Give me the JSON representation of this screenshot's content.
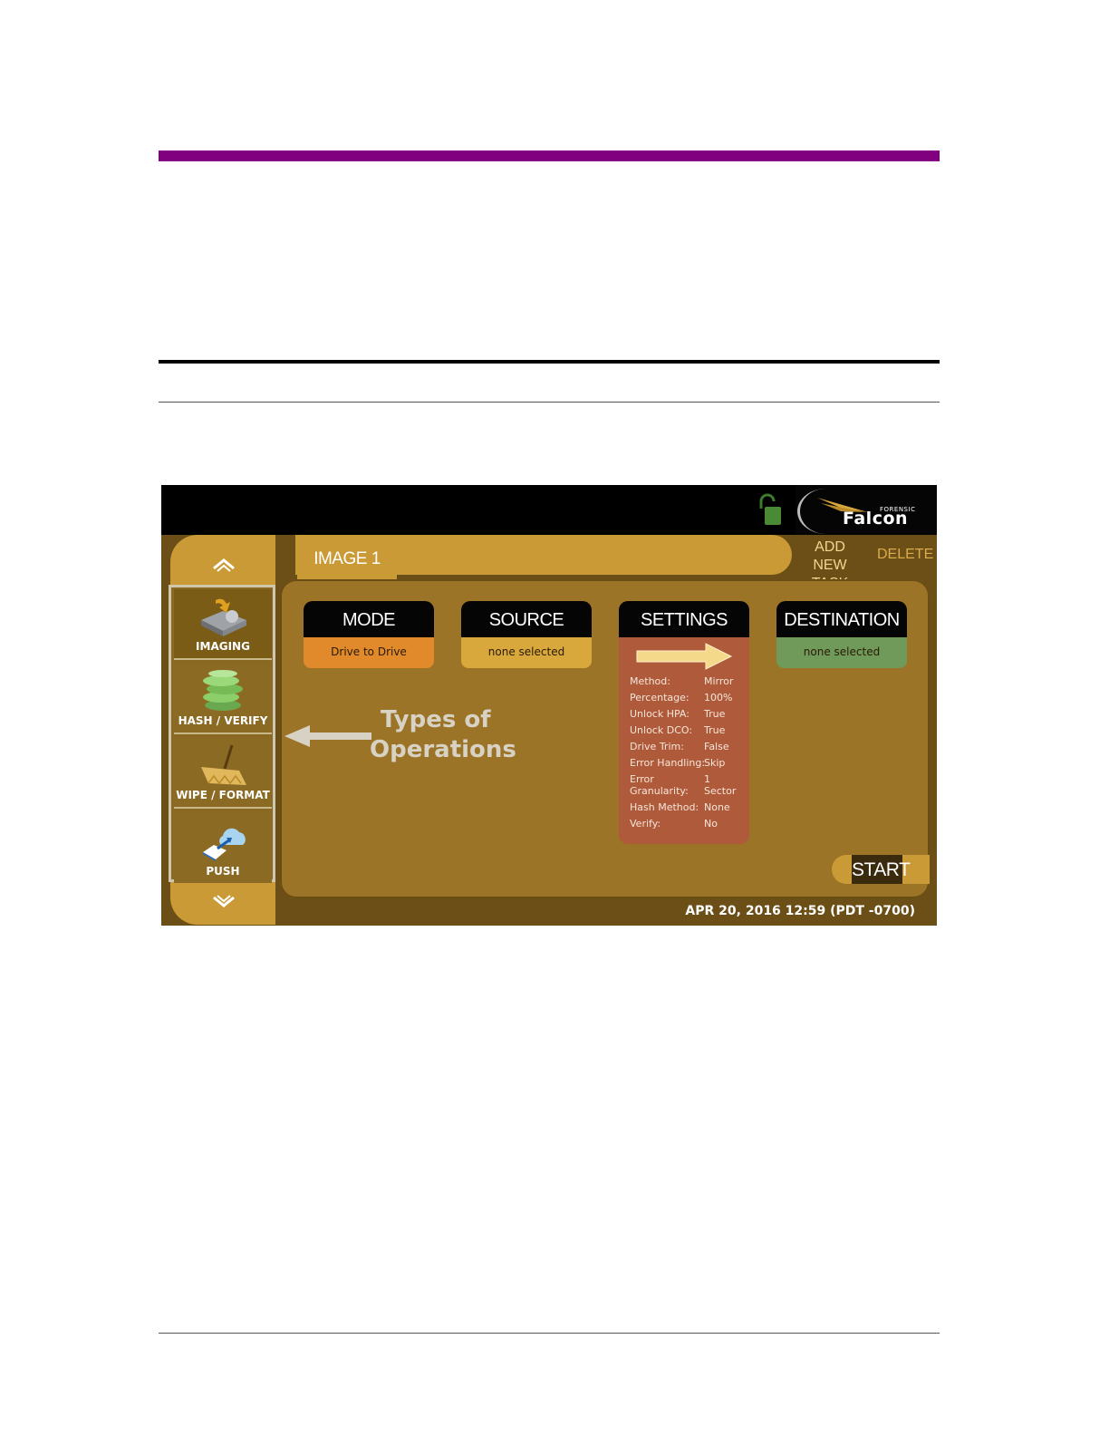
{
  "document": {
    "accent_color": "#800080"
  },
  "screen": {
    "tab": {
      "label": "IMAGE 1"
    },
    "header_actions": {
      "add_task_line1": "ADD NEW",
      "add_task_line2": "TASK",
      "delete_label": "DELETE"
    },
    "logo": {
      "small": "FORENSIC",
      "name": "Falcon"
    },
    "operations": [
      {
        "label": "IMAGING",
        "icon": "imaging-drive-icon"
      },
      {
        "label": "HASH / VERIFY",
        "icon": "hash-stack-icon"
      },
      {
        "label": "WIPE / FORMAT",
        "icon": "broom-icon"
      },
      {
        "label": "PUSH",
        "icon": "cloud-push-icon"
      }
    ],
    "cards": {
      "mode": {
        "title": "MODE",
        "value": "Drive to Drive",
        "color": "#e08a2c"
      },
      "source": {
        "title": "SOURCE",
        "value": "none selected",
        "color": "#d9a83c"
      },
      "settings": {
        "title": "SETTINGS",
        "color": "#b05a3c"
      },
      "destination": {
        "title": "DESTINATION",
        "value": "none selected",
        "color": "#6f9a5a"
      }
    },
    "settings_rows": [
      {
        "key": "Method:",
        "value": "Mirror"
      },
      {
        "key": "Percentage:",
        "value": "100%"
      },
      {
        "key": "Unlock HPA:",
        "value": "True"
      },
      {
        "key": "Unlock DCO:",
        "value": "True"
      },
      {
        "key": "Drive Trim:",
        "value": "False"
      },
      {
        "key": "Error Handling:",
        "value": "Skip"
      },
      {
        "key": "Error",
        "value": "1"
      },
      {
        "key": "Granularity:",
        "value": "Sector"
      },
      {
        "key": "Hash Method:",
        "value": "None"
      },
      {
        "key": "Verify:",
        "value": "No"
      }
    ],
    "annotation": {
      "line1": "Types of",
      "line2": "Operations"
    },
    "start_label": "START",
    "datetime": "APR 20, 2016 12:59 (PDT -0700)"
  }
}
